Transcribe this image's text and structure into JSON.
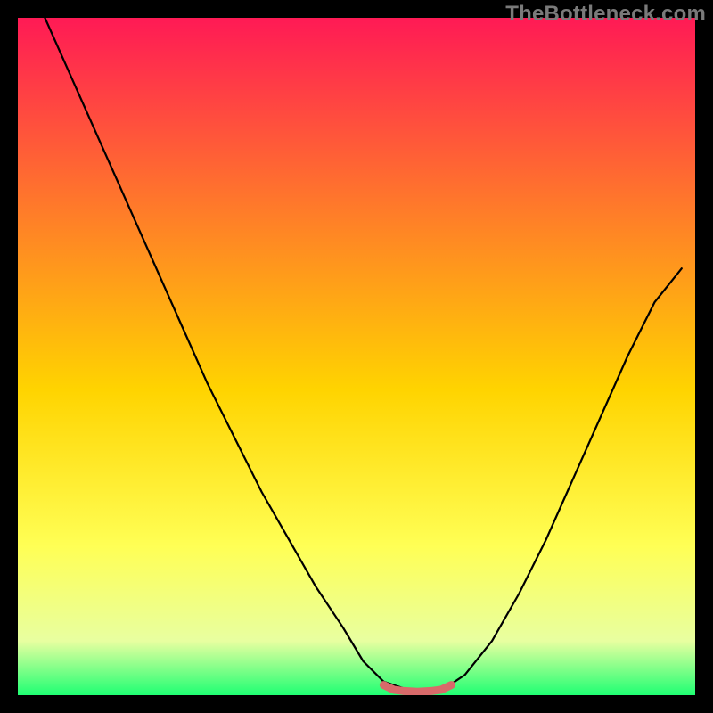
{
  "watermark": "TheBottleneck.com",
  "colors": {
    "frame": "#000000",
    "grad_top": "#ff1a55",
    "grad_mid1": "#ff7a2a",
    "grad_mid2": "#ffd400",
    "grad_mid3": "#ffff55",
    "grad_mid4": "#e8ffa0",
    "grad_bottom": "#1fff73",
    "curve": "#000000",
    "segment": "#d86a6a"
  },
  "chart_data": {
    "type": "line",
    "title": "",
    "xlabel": "",
    "ylabel": "",
    "xlim": [
      0,
      100
    ],
    "ylim": [
      0,
      100
    ],
    "series": [
      {
        "name": "curve",
        "x": [
          4,
          8,
          12,
          16,
          20,
          24,
          28,
          32,
          36,
          40,
          44,
          48,
          51,
          54,
          57,
          59,
          61,
          63,
          66,
          70,
          74,
          78,
          82,
          86,
          90,
          94,
          98
        ],
        "values": [
          100,
          91,
          82,
          73,
          64,
          55,
          46,
          38,
          30,
          23,
          16,
          10,
          5,
          2,
          1,
          0.5,
          0.5,
          1,
          3,
          8,
          15,
          23,
          32,
          41,
          50,
          58,
          63
        ]
      },
      {
        "name": "highlight_segment",
        "x": [
          54,
          55.5,
          57,
          59,
          61,
          62.5,
          64
        ],
        "values": [
          1.5,
          0.8,
          0.6,
          0.5,
          0.6,
          0.8,
          1.5
        ]
      }
    ]
  }
}
